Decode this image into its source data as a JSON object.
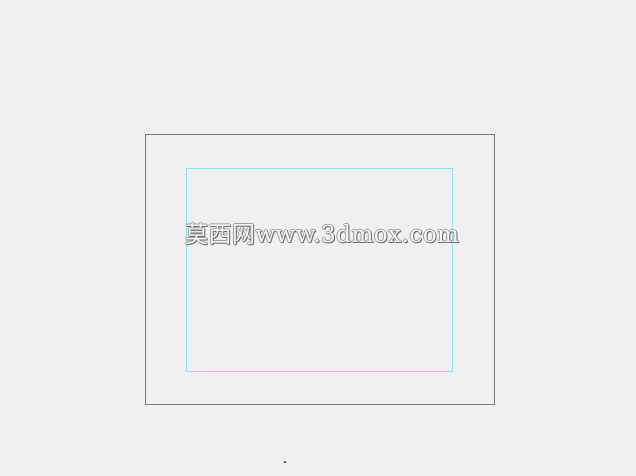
{
  "viewport": {
    "watermark_text": "莫西网www.3dmox.com"
  },
  "colors": {
    "background": "#f0f0f0",
    "outer_frame": "#7a7a7a",
    "safe_frame": "#8fe3ea"
  }
}
